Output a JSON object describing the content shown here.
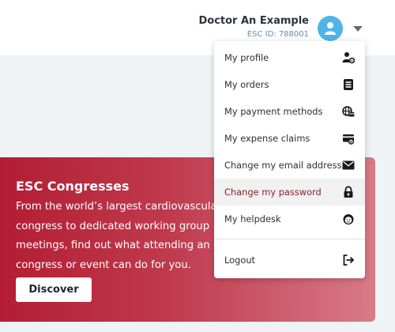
{
  "header": {
    "user_name": "Doctor An Example",
    "user_id": "ESC ID: 788001"
  },
  "colors": {
    "accent_blue": "#4fb4e8",
    "promo_red": "#b31d33",
    "active_text": "#8b1e2c"
  },
  "menu": {
    "items": [
      {
        "label": "My profile",
        "icon": "profile-settings-icon"
      },
      {
        "label": "My orders",
        "icon": "orders-icon"
      },
      {
        "label": "My payment methods",
        "icon": "payment-globe-icon"
      },
      {
        "label": "My expense claims",
        "icon": "expense-card-icon"
      },
      {
        "label": "Change my email address",
        "icon": "envelope-icon"
      },
      {
        "label": "Change my password",
        "icon": "lock-icon",
        "active": true
      },
      {
        "label": "My helpdesk",
        "icon": "helpdesk-icon"
      }
    ],
    "logout": {
      "label": "Logout",
      "icon": "logout-icon"
    }
  },
  "promo": {
    "title": "ESC Congresses",
    "body": "From the world’s largest cardiovascular\ncongress to dedicated working group\nmeetings, find out what attending an\ncongress or event can do for you.",
    "button": "Discover"
  }
}
